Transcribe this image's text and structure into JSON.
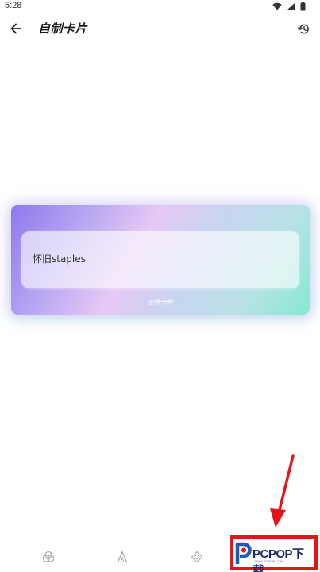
{
  "status_bar": {
    "time": "5:28"
  },
  "app_bar": {
    "title": "自制卡片"
  },
  "card": {
    "text": "怀旧staples",
    "watermark": "小作卡片"
  },
  "bottom_nav": {
    "items": [
      {
        "icon": "layers-icon"
      },
      {
        "icon": "font-icon"
      },
      {
        "icon": "shape-icon"
      }
    ]
  },
  "overlay": {
    "logo_text": "PCPOP下载",
    "logo_subtext": "WWW.PCPOP.COM",
    "annotation_color": "#e5141b"
  },
  "colors": {
    "card_gradient_start": "#8f77ee",
    "card_gradient_end": "#86e8d0"
  }
}
